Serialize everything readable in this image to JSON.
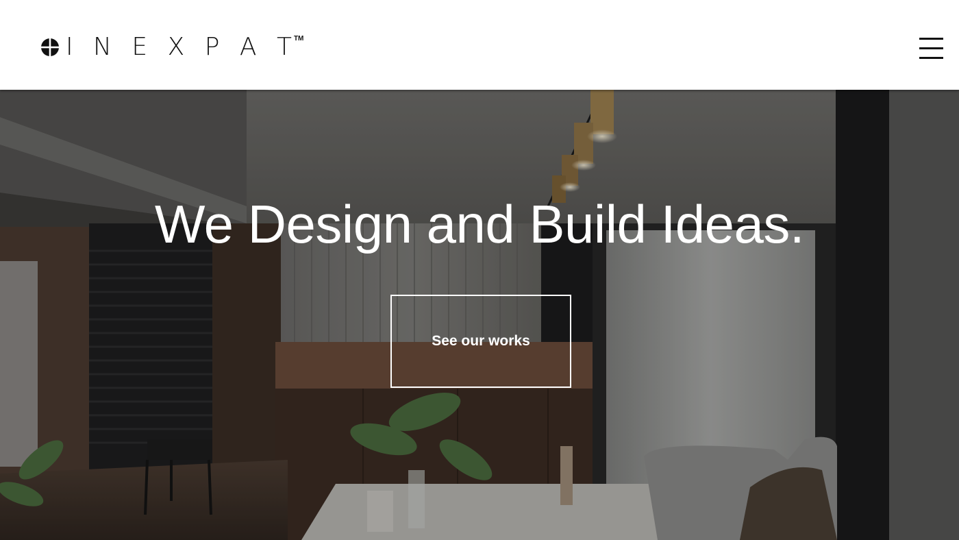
{
  "header": {
    "logo_text": "I N E X P A T",
    "logo_tm": "TM",
    "menu_icon": "hamburger-menu-icon"
  },
  "hero": {
    "headline": "We Design and Build Ideas.",
    "cta_label": "See our works"
  },
  "colors": {
    "header_bg": "#ffffff",
    "text_dark": "#111111",
    "hero_text": "#ffffff"
  }
}
